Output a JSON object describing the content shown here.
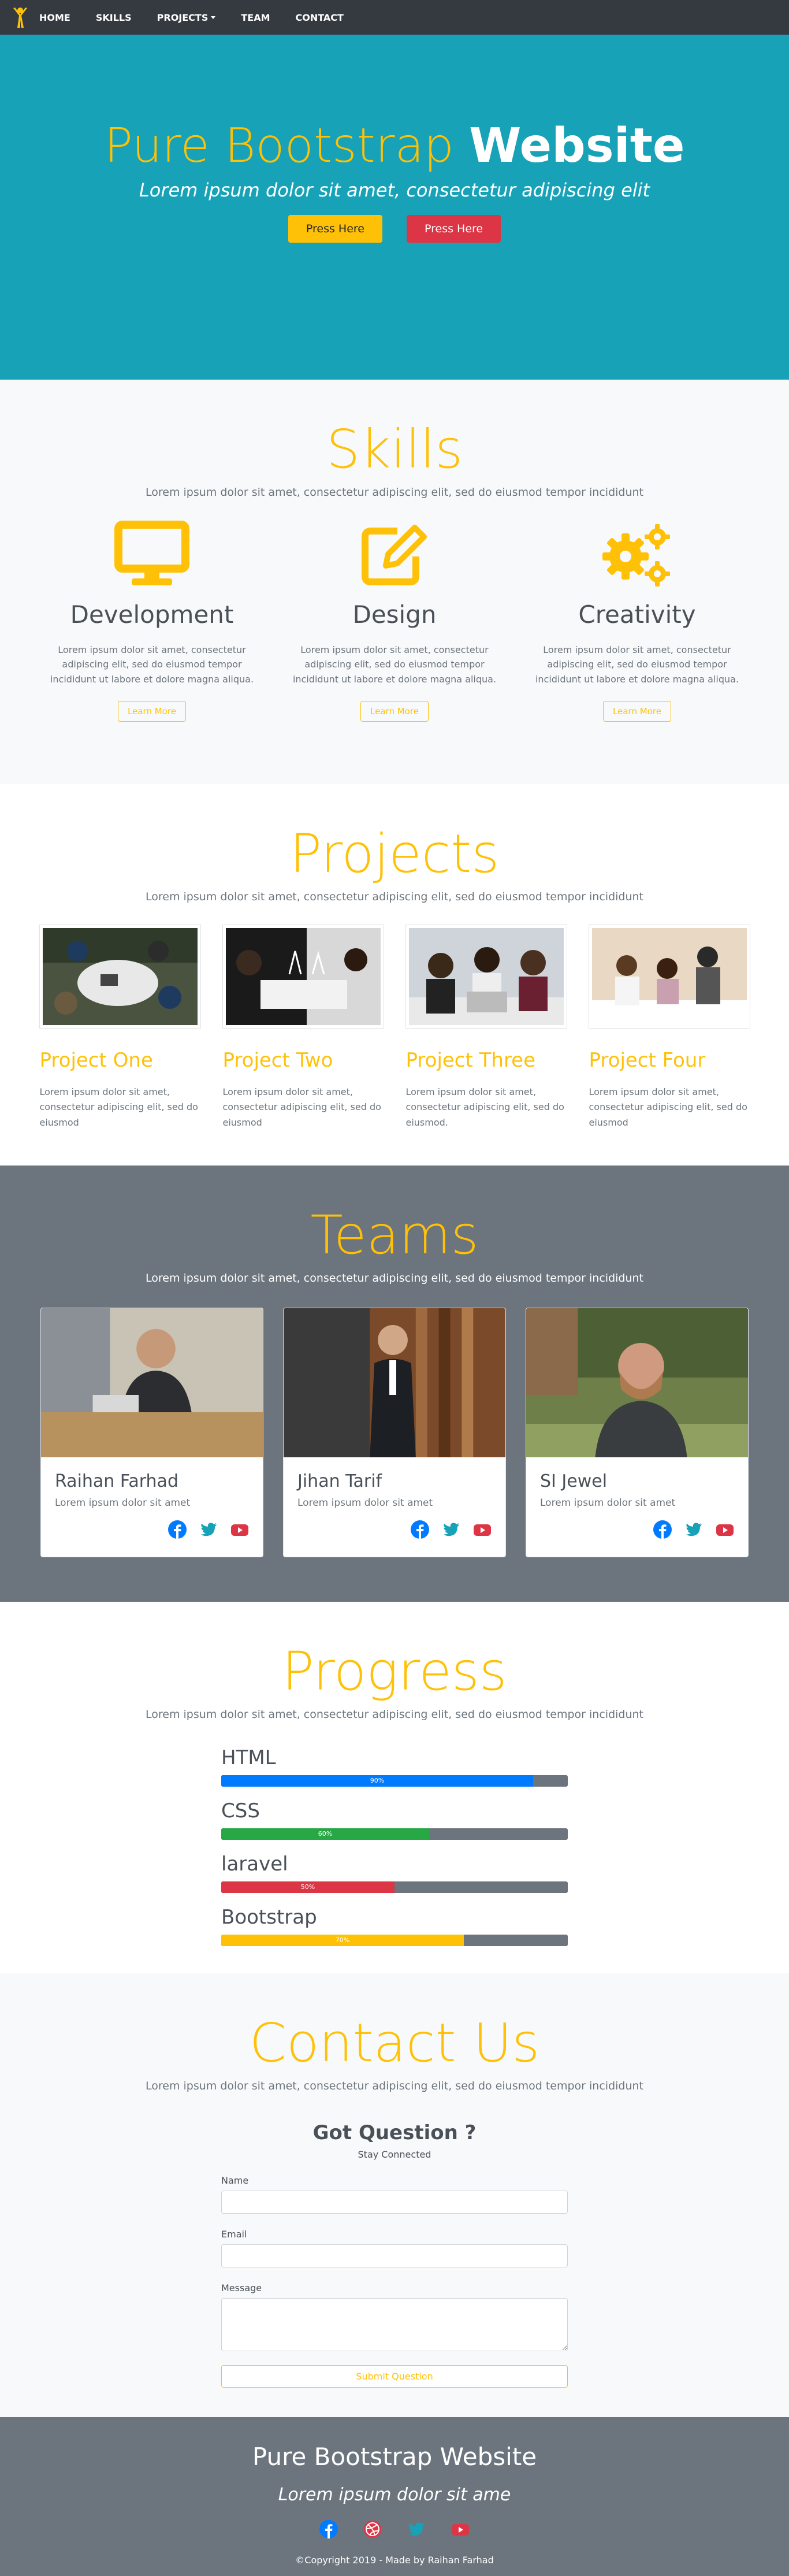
{
  "navbar": {
    "items": [
      {
        "label": "HOME"
      },
      {
        "label": "SKILLS"
      },
      {
        "label": "PROJECTS"
      },
      {
        "label": "TEAM"
      },
      {
        "label": "CONTACT"
      }
    ]
  },
  "hero": {
    "title_light": "Pure Bootstrap ",
    "title_bold": "Website",
    "subtitle": "Lorem ipsum dolor sit amet, consectetur adipiscing elit",
    "btn_primary": "Press Here",
    "btn_secondary": "Press Here"
  },
  "skills": {
    "title": "Skills",
    "subtitle": "Lorem ipsum dolor sit amet, consectetur adipiscing elit, sed do eiusmod tempor incididunt",
    "items": [
      {
        "icon": "monitor-icon",
        "title": "Development",
        "text": "Lorem ipsum dolor sit amet, consectetur adipiscing elit, sed do eiusmod tempor incididunt ut labore et dolore magna aliqua.",
        "button": "Learn More"
      },
      {
        "icon": "edit-icon",
        "title": "Design",
        "text": "Lorem ipsum dolor sit amet, consectetur adipiscing elit, sed do eiusmod tempor incididunt ut labore et dolore magna aliqua.",
        "button": "Learn More"
      },
      {
        "icon": "cogs-icon",
        "title": "Creativity",
        "text": "Lorem ipsum dolor sit amet, consectetur adipiscing elit, sed do eiusmod tempor incididunt ut labore et dolore magna aliqua.",
        "button": "Learn More"
      }
    ]
  },
  "projects": {
    "title": "Projects",
    "subtitle": "Lorem ipsum dolor sit amet, consectetur adipiscing elit, sed do eiusmod tempor incididunt",
    "items": [
      {
        "title": "Project One",
        "text": "Lorem ipsum dolor sit amet, consectetur adipiscing elit, sed do eiusmod"
      },
      {
        "title": "Project Two",
        "text": "Lorem ipsum dolor sit amet, consectetur adipiscing elit, sed do eiusmod"
      },
      {
        "title": "Project Three",
        "text": "Lorem ipsum dolor sit amet, consectetur adipiscing elit, sed do eiusmod."
      },
      {
        "title": "Project Four",
        "text": "Lorem ipsum dolor sit amet, consectetur adipiscing elit, sed do eiusmod"
      }
    ]
  },
  "teams": {
    "title": "Teams",
    "subtitle": "Lorem ipsum dolor sit amet, consectetur adipiscing elit, sed do eiusmod tempor incididunt",
    "members": [
      {
        "name": "Raihan Farhad",
        "role": "Lorem ipsum dolor sit amet"
      },
      {
        "name": "Jihan Tarif",
        "role": "Lorem ipsum dolor sit amet"
      },
      {
        "name": "SI Jewel",
        "role": "Lorem ipsum dolor sit amet"
      }
    ]
  },
  "progress": {
    "title": "Progress",
    "subtitle": "Lorem ipsum dolor sit amet, consectetur adipiscing elit, sed do eiusmod tempor incididunt",
    "skills": [
      {
        "name": "HTML",
        "percent": 90,
        "label": "90%",
        "color": "#007bff"
      },
      {
        "name": "CSS",
        "percent": 60,
        "label": "60%",
        "color": "#28a745"
      },
      {
        "name": "laravel",
        "percent": 50,
        "label": "50%",
        "color": "#dc3545"
      },
      {
        "name": "Bootstrap",
        "percent": 70,
        "label": "70%",
        "color": "#ffc107"
      }
    ]
  },
  "contact": {
    "title": "Contact Us",
    "subtitle": "Lorem ipsum dolor sit amet, consectetur adipiscing elit, sed do eiusmod tempor incididunt",
    "heading": "Got Question ?",
    "subheading": "Stay Connected",
    "name_label": "Name",
    "email_label": "Email",
    "message_label": "Message",
    "submit": "Submit Question"
  },
  "footer": {
    "title": "Pure Bootstrap Website",
    "subtitle": "Lorem ipsum dolor sit ame",
    "copyright": "©Copyright 2019 - Made by Raihan Farhad"
  },
  "colors": {
    "accent": "#ffc107",
    "hero_bg": "#17a2b8",
    "dark": "#343a40",
    "gray": "#6c757d"
  }
}
